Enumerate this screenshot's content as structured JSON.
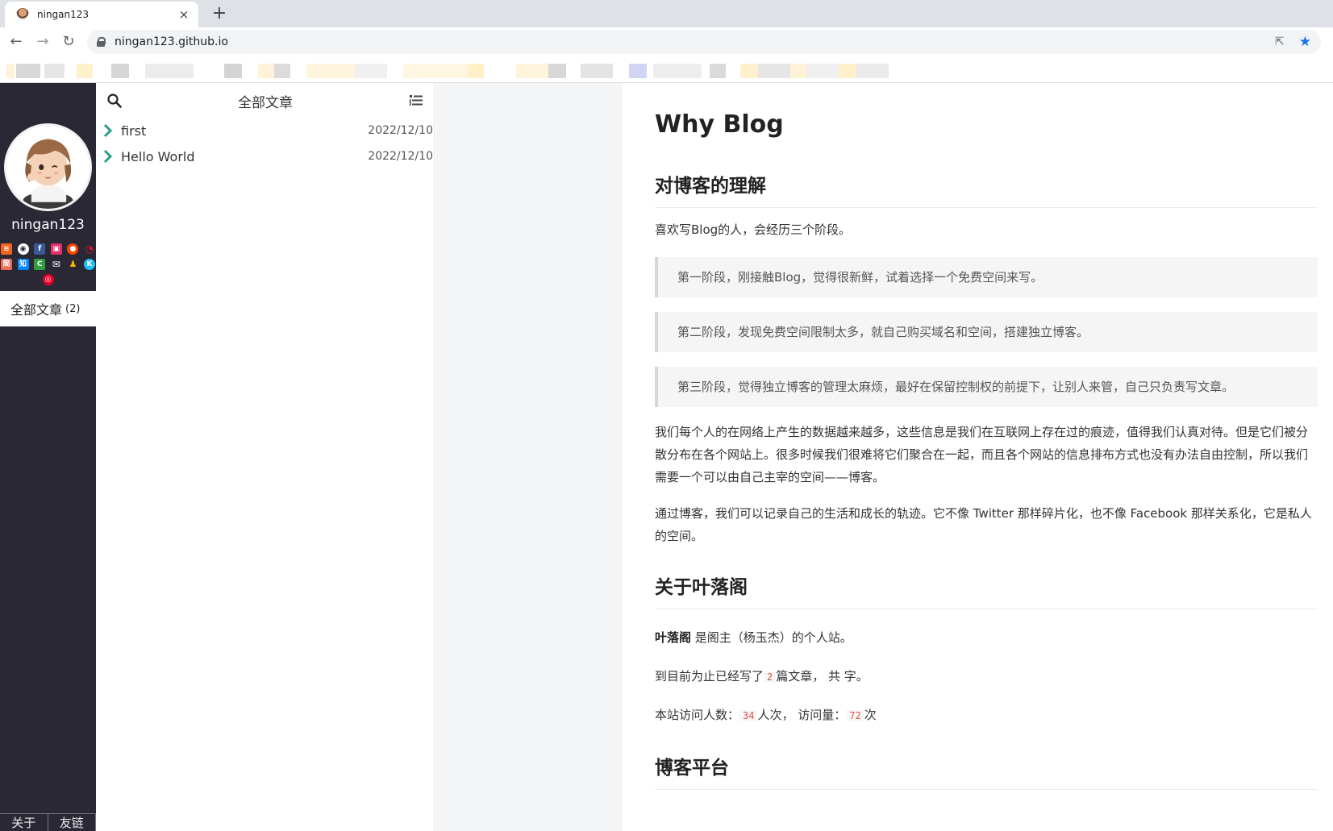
{
  "browser": {
    "tab_title": "ningan123",
    "tab_close": "×",
    "new_tab": "+",
    "url": "ningan123.github.io",
    "back": "←",
    "forward": "→",
    "reload": "↻",
    "share": "⇱",
    "bookmark_star": "★"
  },
  "sidebar": {
    "username": "ningan123",
    "social_row1": [
      {
        "name": "rss-icon",
        "glyph": "",
        "color": "#f26522"
      },
      {
        "name": "github-icon",
        "glyph": "",
        "color": "#ffffff"
      },
      {
        "name": "facebook-icon",
        "glyph": "f",
        "color": "#3b5998"
      },
      {
        "name": "instagram-icon",
        "glyph": "",
        "color": "#e1306c"
      },
      {
        "name": "reddit-icon",
        "glyph": "",
        "color": "#ff4500"
      },
      {
        "name": "weibo-icon",
        "glyph": "",
        "color": "#e6162d"
      }
    ],
    "social_row2": [
      {
        "name": "jianshu-icon",
        "glyph": "简",
        "color": "#ea6f5a"
      },
      {
        "name": "zhihu-icon",
        "glyph": "知",
        "color": "#0084ff"
      },
      {
        "name": "csdn-icon",
        "glyph": "C",
        "color": "#2e9e40"
      },
      {
        "name": "mail-icon",
        "glyph": "✉",
        "color": "#2a2835"
      },
      {
        "name": "qq-icon",
        "glyph": "",
        "color": "#2a2835"
      },
      {
        "name": "kaggle-icon",
        "glyph": "K",
        "color": "#20beff"
      }
    ],
    "social_row3": [
      {
        "name": "netease-music-icon",
        "glyph": "◎",
        "color": "#e60026"
      }
    ],
    "nav": {
      "label": "全部文章",
      "count": "(2)"
    },
    "footer": {
      "about": "关于",
      "links": "友链"
    }
  },
  "list": {
    "title": "全部文章",
    "posts": [
      {
        "title": "first",
        "date": "2022/12/10"
      },
      {
        "title": "Hello World",
        "date": "2022/12/10"
      }
    ]
  },
  "article": {
    "title": "Why Blog",
    "section1": {
      "heading": "对博客的理解",
      "intro": "喜欢写Blog的人，会经历三个阶段。",
      "quotes": [
        "第一阶段，刚接触Blog，觉得很新鲜，试着选择一个免费空间来写。",
        "第二阶段，发现免费空间限制太多，就自己购买域名和空间，搭建独立博客。",
        "第三阶段，觉得独立博客的管理太麻烦，最好在保留控制权的前提下，让别人来管，自己只负责写文章。"
      ],
      "para1": "我们每个人的在网络上产生的数据越来越多，这些信息是我们在互联网上存在过的痕迹，值得我们认真对待。但是它们被分散分布在各个网站上。很多时候我们很难将它们聚合在一起，而且各个网站的信息排布方式也没有办法自由控制，所以我们需要一个可以由自己主宰的空间——博客。",
      "para2": "通过博客，我们可以记录自己的生活和成长的轨迹。它不像 Twitter 那样碎片化，也不像 Facebook 那样关系化，它是私人的空间。"
    },
    "section2": {
      "heading": "关于叶落阁",
      "owner_bold": "叶落阁",
      "owner_rest": " 是阁主（杨玉杰）的个人站。",
      "count_prefix": "到目前为止已经写了",
      "post_count": "2",
      "count_mid": "篇文章， 共 ",
      "count_suffix": " 字。",
      "visit_prefix": "本站访问人数：",
      "visitors": "34",
      "visit_mid": "人次， 访问量：",
      "views": "72",
      "visit_suffix": "次"
    },
    "section3": {
      "heading": "博客平台"
    }
  }
}
